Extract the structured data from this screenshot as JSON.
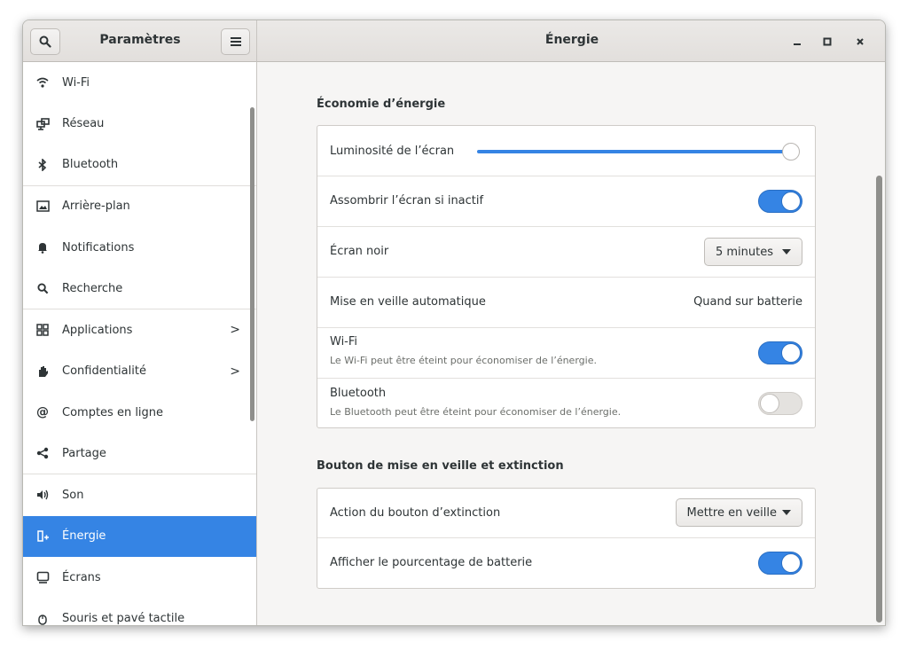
{
  "header": {
    "left_title": "Paramètres",
    "right_title": "Énergie",
    "minimize_glyph": "–",
    "maximize_glyph": "▫",
    "close_glyph": "×"
  },
  "sidebar": {
    "items": [
      {
        "label": "Wi-Fi",
        "icon": "wifi-icon"
      },
      {
        "label": "Réseau",
        "icon": "network-icon"
      },
      {
        "label": "Bluetooth",
        "icon": "bluetooth-icon"
      },
      {
        "label": "Arrière-plan",
        "icon": "background-icon"
      },
      {
        "label": "Notifications",
        "icon": "bell-icon"
      },
      {
        "label": "Recherche",
        "icon": "search-icon"
      },
      {
        "label": "Applications",
        "icon": "apps-grid-icon"
      },
      {
        "label": "Confidentialité",
        "icon": "hand-icon"
      },
      {
        "label": "Comptes en ligne",
        "icon": "at-sign-icon"
      },
      {
        "label": "Partage",
        "icon": "share-icon"
      },
      {
        "label": "Son",
        "icon": "speaker-icon"
      },
      {
        "label": "Énergie",
        "icon": "power-icon"
      },
      {
        "label": "Écrans",
        "icon": "display-icon"
      },
      {
        "label": "Souris et pavé tactile",
        "icon": "mouse-icon"
      }
    ],
    "active": "Énergie",
    "chevron": ">"
  },
  "power_saving": {
    "title": "Économie d’énergie",
    "brightness_label": "Luminosité de l’écran",
    "brightness_level": 1.0,
    "dim_label": "Assombrir l’écran si inactif",
    "dim_on": true,
    "blank_label": "Écran noir",
    "blank_value": "5 minutes",
    "suspend_label": "Mise en veille automatique",
    "suspend_value": "Quand sur batterie",
    "wifi_label": "Wi-Fi",
    "wifi_sub": "Le Wi-Fi peut être éteint pour économiser de l’énergie.",
    "wifi_on": true,
    "bt_label": "Bluetooth",
    "bt_sub": "Le Bluetooth peut être éteint pour économiser de l’énergie.",
    "bt_on": false
  },
  "power_button": {
    "title": "Bouton de mise en veille et extinction",
    "action_label": "Action du bouton d’extinction",
    "action_value": "Mettre en veille",
    "battery_pct_label": "Afficher le pourcentage de batterie",
    "battery_pct_on": true
  },
  "colors": {
    "accent": "#3584e4",
    "sidebar_bg": "#ffffff",
    "content_bg": "#f6f5f4"
  }
}
